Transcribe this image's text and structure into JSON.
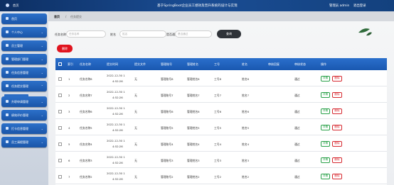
{
  "header": {
    "home": "首页",
    "title": "基于SpringBoot企业员工绩效及晋升系统的设计与实现",
    "user": "管理员 admin",
    "logout": "退出登录"
  },
  "sidebar": {
    "items": [
      {
        "label": "首页"
      },
      {
        "label": "个人中心"
      },
      {
        "label": "员工管理"
      },
      {
        "label": "管理部门管理"
      },
      {
        "label": "任务信息管理"
      },
      {
        "label": "任务提交管理"
      },
      {
        "label": "升职申请管理"
      },
      {
        "label": "绩效评价管理"
      },
      {
        "label": "打卡信息管理"
      },
      {
        "label": "员工请假管理"
      }
    ],
    "sub_item": "任务提交"
  },
  "breadcrumb": {
    "home": "首页",
    "separator": "/",
    "current": "任务提交"
  },
  "filters": {
    "task_name_label": "任务名称",
    "task_name_placeholder": "任务名称",
    "name_label": "姓名",
    "name_placeholder": "姓名",
    "review_label": "是否通过",
    "review_placeholder": "是否通过",
    "search_button": "查询"
  },
  "toolbar": {
    "delete_button": "删除"
  },
  "table": {
    "columns": [
      "索引",
      "任务名称",
      "提交时间",
      "提交文件",
      "管理账号",
      "管理姓名",
      "工号",
      "姓名",
      "审核回复",
      "审核状态",
      "操作"
    ],
    "detail_label": "详情",
    "delete_label": "删除",
    "rows": [
      {
        "index": "1",
        "task": "任务名称8",
        "date": "2022-12-30 1",
        "time": "4:52:26",
        "file": "无",
        "account": "管理账号8",
        "mgr_name": "管理姓名8",
        "emp_no": "工号8",
        "name": "姓名8",
        "reply": "",
        "status": "通过"
      },
      {
        "index": "2",
        "task": "任务名称7",
        "date": "2022-12-30 1",
        "time": "4:52:26",
        "file": "无",
        "account": "管理账号7",
        "mgr_name": "管理姓名7",
        "emp_no": "工号7",
        "name": "姓名7",
        "reply": "",
        "status": "通过"
      },
      {
        "index": "3",
        "task": "任务名称6",
        "date": "2022-12-30 1",
        "time": "4:52:26",
        "file": "无",
        "account": "管理账号6",
        "mgr_name": "管理姓名6",
        "emp_no": "工号6",
        "name": "姓名6",
        "reply": "",
        "status": "通过"
      },
      {
        "index": "4",
        "task": "任务名称5",
        "date": "2022-12-30 1",
        "time": "4:52:26",
        "file": "无",
        "account": "管理账号5",
        "mgr_name": "管理姓名5",
        "emp_no": "工号5",
        "name": "姓名5",
        "reply": "",
        "status": "通过"
      },
      {
        "index": "5",
        "task": "任务名称4",
        "date": "2022-12-30 1",
        "time": "4:52:26",
        "file": "无",
        "account": "管理账号4",
        "mgr_name": "管理姓名4",
        "emp_no": "工号4",
        "name": "姓名4",
        "reply": "",
        "status": "通过"
      },
      {
        "index": "6",
        "task": "任务名称3",
        "date": "2022-12-30 1",
        "time": "4:52:26",
        "file": "无",
        "account": "管理账号3",
        "mgr_name": "管理姓名3",
        "emp_no": "工号3",
        "name": "姓名3",
        "reply": "",
        "status": "通过"
      },
      {
        "index": "7",
        "task": "任务名称2",
        "date": "2022-12-30 1",
        "time": "4:52:26",
        "file": "无",
        "account": "管理账号2",
        "mgr_name": "管理姓名2",
        "emp_no": "工号2",
        "name": "姓名2",
        "reply": "",
        "status": "通过"
      }
    ]
  }
}
